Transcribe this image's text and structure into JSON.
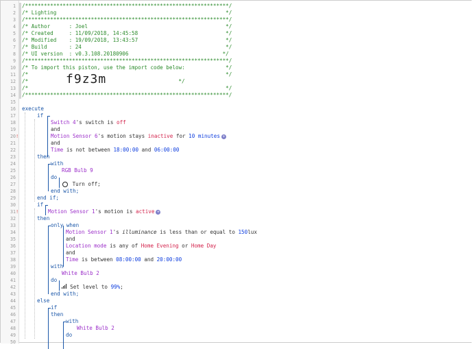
{
  "lines": [
    {
      "n": "1",
      "mark": "",
      "indent": 0,
      "parts": [
        [
          "c",
          "/*****************************************************************/"
        ]
      ]
    },
    {
      "n": "2",
      "mark": "",
      "indent": 0,
      "parts": [
        [
          "c",
          "/* Lighting                                                      */"
        ]
      ]
    },
    {
      "n": "3",
      "mark": "",
      "indent": 0,
      "parts": [
        [
          "c",
          "/*****************************************************************/"
        ]
      ]
    },
    {
      "n": "4",
      "mark": "",
      "indent": 0,
      "parts": [
        [
          "c",
          "/* Author      : Joel                                            */"
        ]
      ]
    },
    {
      "n": "5",
      "mark": "",
      "indent": 0,
      "parts": [
        [
          "c",
          "/* Created     : 11/09/2018, 14:45:58                            */"
        ]
      ]
    },
    {
      "n": "6",
      "mark": "",
      "indent": 0,
      "parts": [
        [
          "c",
          "/* Modified    : 19/09/2018, 13:43:57                            */"
        ]
      ]
    },
    {
      "n": "7",
      "mark": "",
      "indent": 0,
      "parts": [
        [
          "c",
          "/* Build       : 24                                              */"
        ]
      ]
    },
    {
      "n": "8",
      "mark": "",
      "indent": 0,
      "parts": [
        [
          "c",
          "/* UI version  : v0.3.108.20180906                              */"
        ]
      ]
    },
    {
      "n": "9",
      "mark": "",
      "indent": 0,
      "parts": [
        [
          "c",
          "/*****************************************************************/"
        ]
      ]
    },
    {
      "n": "10",
      "mark": "",
      "indent": 0,
      "parts": [
        [
          "c",
          "/* To import this piston, use the import code below:             */"
        ]
      ]
    },
    {
      "n": "11",
      "mark": "",
      "indent": 0,
      "parts": [
        [
          "c",
          "/*                                                               */"
        ]
      ]
    },
    {
      "n": "12",
      "mark": "",
      "indent": 0,
      "big": true,
      "parts": [
        [
          "c",
          "/*"
        ],
        [
          "t",
          "            "
        ],
        [
          "big",
          "f9z3m"
        ],
        [
          "t",
          "       "
        ],
        [
          "c",
          "                */"
        ]
      ]
    },
    {
      "n": "13",
      "mark": "",
      "indent": 0,
      "parts": [
        [
          "c",
          "/*                                                               */"
        ]
      ]
    },
    {
      "n": "14",
      "mark": "",
      "indent": 0,
      "parts": [
        [
          "c",
          "/*****************************************************************/"
        ]
      ]
    },
    {
      "n": "15",
      "mark": "",
      "indent": 0,
      "parts": []
    },
    {
      "n": "16",
      "mark": "",
      "indent": 0,
      "parts": [
        [
          "kw",
          "execute"
        ]
      ]
    },
    {
      "n": "17",
      "mark": "",
      "indent": 22,
      "parts": [
        [
          "kw",
          "if"
        ]
      ]
    },
    {
      "n": "18",
      "mark": "",
      "indent": 42,
      "parts": [
        [
          "dev",
          "Switch 4"
        ],
        [
          "t",
          "'s switch is "
        ],
        [
          "val",
          "off"
        ]
      ]
    },
    {
      "n": "19",
      "mark": "",
      "indent": 42,
      "parts": [
        [
          "t",
          "and"
        ]
      ]
    },
    {
      "n": "20",
      "mark": "!",
      "indent": 42,
      "parts": [
        [
          "dev",
          "Motion Sensor 6"
        ],
        [
          "t",
          "'s motion stays "
        ],
        [
          "val",
          "inactive"
        ],
        [
          "t",
          " for "
        ],
        [
          "num",
          "10 minutes"
        ],
        [
          "plus",
          "+"
        ]
      ]
    },
    {
      "n": "21",
      "mark": "",
      "indent": 42,
      "parts": [
        [
          "t",
          "and"
        ]
      ]
    },
    {
      "n": "22",
      "mark": "",
      "indent": 42,
      "parts": [
        [
          "dev",
          "Time"
        ],
        [
          "t",
          " is not between "
        ],
        [
          "num",
          "18:00:00"
        ],
        [
          "t",
          " and "
        ],
        [
          "num",
          "06:00:00"
        ]
      ]
    },
    {
      "n": "23",
      "mark": "",
      "indent": 22,
      "parts": [
        [
          "kw",
          "then"
        ]
      ]
    },
    {
      "n": "24",
      "mark": "",
      "indent": 42,
      "parts": [
        [
          "kw",
          "with"
        ]
      ]
    },
    {
      "n": "25",
      "mark": "",
      "indent": 58,
      "parts": [
        [
          "dev",
          "RGB Bulb 9"
        ]
      ]
    },
    {
      "n": "26",
      "mark": "",
      "indent": 42,
      "parts": [
        [
          "kw",
          "do"
        ]
      ]
    },
    {
      "n": "27",
      "mark": "",
      "indent": 58,
      "icon": "power",
      "parts": [
        [
          "t",
          " Turn off;"
        ]
      ]
    },
    {
      "n": "28",
      "mark": "",
      "indent": 42,
      "parts": [
        [
          "kw",
          "end with;"
        ]
      ]
    },
    {
      "n": "29",
      "mark": "",
      "indent": 22,
      "parts": [
        [
          "kw",
          "end if;"
        ]
      ]
    },
    {
      "n": "30",
      "mark": "",
      "indent": 22,
      "parts": [
        [
          "kw",
          "if"
        ]
      ]
    },
    {
      "n": "31",
      "mark": "!",
      "indent": 38,
      "parts": [
        [
          "dev",
          "Motion Sensor 1"
        ],
        [
          "t",
          "'s motion is "
        ],
        [
          "val",
          "active"
        ],
        [
          "plus",
          "+"
        ]
      ]
    },
    {
      "n": "32",
      "mark": "",
      "indent": 22,
      "parts": [
        [
          "kw",
          "then"
        ]
      ]
    },
    {
      "n": "33",
      "mark": "",
      "indent": 42,
      "parts": [
        [
          "kw",
          "only when"
        ]
      ]
    },
    {
      "n": "34",
      "mark": "",
      "indent": 64,
      "parts": [
        [
          "dev",
          "Motion Sensor 1"
        ],
        [
          "t",
          "'s "
        ],
        [
          "it",
          "illuminance"
        ],
        [
          "t",
          " is less than or equal to "
        ],
        [
          "num",
          "150"
        ],
        [
          "t",
          "lux"
        ]
      ]
    },
    {
      "n": "35",
      "mark": "",
      "indent": 64,
      "parts": [
        [
          "t",
          "and"
        ]
      ]
    },
    {
      "n": "36",
      "mark": "",
      "indent": 64,
      "parts": [
        [
          "dev",
          "Location mode"
        ],
        [
          "t",
          " is any of "
        ],
        [
          "val",
          "Home Evening"
        ],
        [
          "t",
          " or "
        ],
        [
          "val",
          "Home Day"
        ]
      ]
    },
    {
      "n": "37",
      "mark": "",
      "indent": 64,
      "parts": [
        [
          "t",
          "and"
        ]
      ]
    },
    {
      "n": "38",
      "mark": "",
      "indent": 64,
      "parts": [
        [
          "dev",
          "Time"
        ],
        [
          "t",
          " is between "
        ],
        [
          "num",
          "08:00:00"
        ],
        [
          "t",
          " and "
        ],
        [
          "num",
          "20:00:00"
        ]
      ]
    },
    {
      "n": "39",
      "mark": "",
      "indent": 42,
      "parts": [
        [
          "kw",
          "with"
        ]
      ]
    },
    {
      "n": "40",
      "mark": "",
      "indent": 58,
      "parts": [
        [
          "dev",
          "White Bulb 2"
        ]
      ]
    },
    {
      "n": "41",
      "mark": "",
      "indent": 42,
      "parts": [
        [
          "kw",
          "do"
        ]
      ]
    },
    {
      "n": "42",
      "mark": "",
      "indent": 58,
      "icon": "bars",
      "parts": [
        [
          "t",
          " Set level to "
        ],
        [
          "num",
          "99%"
        ],
        [
          "t",
          ";"
        ]
      ]
    },
    {
      "n": "43",
      "mark": "",
      "indent": 42,
      "parts": [
        [
          "kw",
          "end with;"
        ]
      ]
    },
    {
      "n": "44",
      "mark": "",
      "indent": 22,
      "parts": [
        [
          "kw",
          "else"
        ]
      ]
    },
    {
      "n": "45",
      "mark": "",
      "indent": 42,
      "parts": [
        [
          "kw",
          "if"
        ]
      ]
    },
    {
      "n": "46",
      "mark": "",
      "indent": 42,
      "parts": [
        [
          "kw",
          "then"
        ]
      ]
    },
    {
      "n": "47",
      "mark": "",
      "indent": 64,
      "parts": [
        [
          "kw",
          "with"
        ]
      ]
    },
    {
      "n": "48",
      "mark": "",
      "indent": 80,
      "parts": [
        [
          "dev",
          "White Bulb 2"
        ]
      ]
    },
    {
      "n": "49",
      "mark": "",
      "indent": 64,
      "parts": [
        [
          "kw",
          "do"
        ]
      ]
    },
    {
      "n": "50",
      "mark": "",
      "indent": 80,
      "parts": []
    }
  ],
  "colors": {
    "comment": "#2a8a2a",
    "keyword": "#1a56a8",
    "device": "#9b2ec9",
    "number": "#0c3cde",
    "value": "#d3224b"
  }
}
